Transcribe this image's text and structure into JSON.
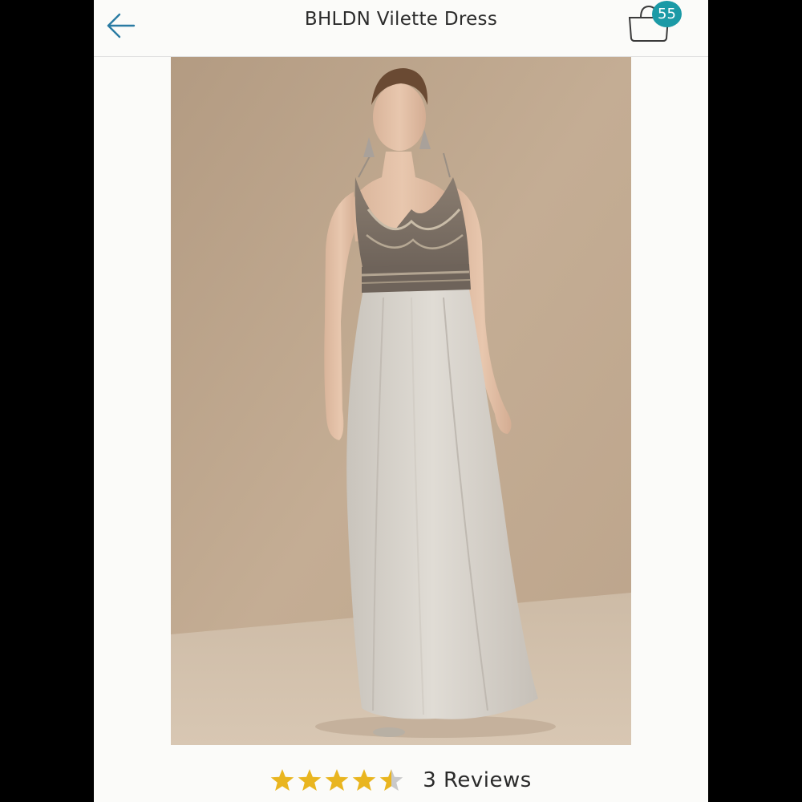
{
  "header": {
    "title": "BHLDN Vilette Dress",
    "back_icon": "arrow-left-icon",
    "bag_icon": "shopping-bag-icon",
    "bag_count": "55"
  },
  "product": {
    "image_icon": "product-photo"
  },
  "reviews": {
    "rating": 4.5,
    "max_rating": 5,
    "count_label": "3 Reviews"
  },
  "colors": {
    "accent": "#1b9aa6",
    "star": "#e9b51f",
    "star_empty": "#c9c9c9",
    "backdrop": "#bfa88f"
  }
}
